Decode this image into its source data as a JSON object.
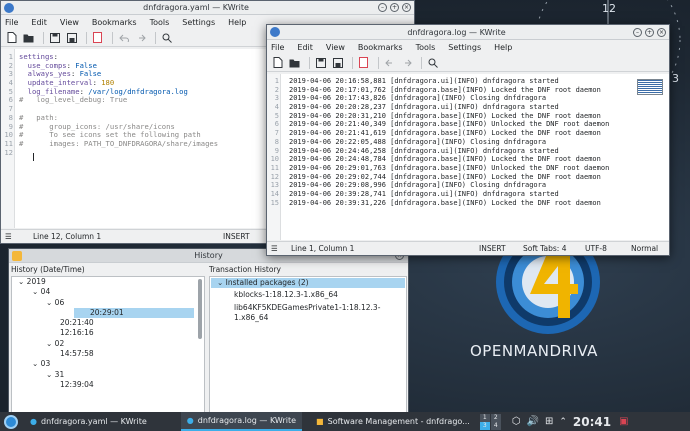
{
  "yaml_window": {
    "title": "dnfdragora.yaml — KWrite",
    "menu": [
      "File",
      "Edit",
      "View",
      "Bookmarks",
      "Tools",
      "Settings",
      "Help"
    ],
    "lines": [
      {
        "n": "1",
        "t": "settings:"
      },
      {
        "n": "2",
        "t": "  use_comps: False"
      },
      {
        "n": "3",
        "t": "  always_yes: False"
      },
      {
        "n": "4",
        "t": "  update_interval: 180"
      },
      {
        "n": "5",
        "t": "  log_filename: /var/log/dnfdragora.log"
      },
      {
        "n": "6",
        "t": "#   log_level_debug: True"
      },
      {
        "n": "7",
        "t": ""
      },
      {
        "n": "8",
        "t": "#   path:"
      },
      {
        "n": "9",
        "t": "#      group_icons: /usr/share/icons"
      },
      {
        "n": "10",
        "t": "#      To see icons set the following path"
      },
      {
        "n": "11",
        "t": "#      images: PATH_TO_DNFDRAGORA/share/images"
      },
      {
        "n": "12",
        "t": ""
      }
    ],
    "status_pos": "Line 12, Column 1",
    "status_mode": "INSERT"
  },
  "log_window": {
    "title": "dnfdragora.log — KWrite",
    "menu": [
      "File",
      "Edit",
      "View",
      "Bookmarks",
      "Tools",
      "Settings",
      "Help"
    ],
    "lines": [
      {
        "n": "1",
        "t": "2019-04-06 20:16:58,881 [dnfdragora.ui](INFO) dnfdragora started"
      },
      {
        "n": "2",
        "t": "2019-04-06 20:17:01,762 [dnfdragora.base](INFO) Locked the DNF root daemon"
      },
      {
        "n": "3",
        "t": "2019-04-06 20:17:43,826 [dnfdragora](INFO) Closing dnfdragora"
      },
      {
        "n": "4",
        "t": "2019-04-06 20:20:28,237 [dnfdragora.ui](INFO) dnfdragora started"
      },
      {
        "n": "5",
        "t": "2019-04-06 20:20:31,210 [dnfdragora.base](INFO) Locked the DNF root daemon"
      },
      {
        "n": "6",
        "t": "2019-04-06 20:21:40,349 [dnfdragora.base](INFO) Unlocked the DNF root daemon"
      },
      {
        "n": "7",
        "t": "2019-04-06 20:21:41,619 [dnfdragora.base](INFO) Locked the DNF root daemon"
      },
      {
        "n": "8",
        "t": "2019-04-06 20:22:05,488 [dnfdragora](INFO) Closing dnfdragora"
      },
      {
        "n": "9",
        "t": "2019-04-06 20:24:46,258 [dnfdragora.ui](INFO) dnfdragora started"
      },
      {
        "n": "10",
        "t": "2019-04-06 20:24:48,784 [dnfdragora.base](INFO) Locked the DNF root daemon"
      },
      {
        "n": "11",
        "t": "2019-04-06 20:29:01,763 [dnfdragora.base](INFO) Unlocked the DNF root daemon"
      },
      {
        "n": "12",
        "t": "2019-04-06 20:29:02,744 [dnfdragora.base](INFO) Locked the DNF root daemon"
      },
      {
        "n": "13",
        "t": "2019-04-06 20:29:08,996 [dnfdragora](INFO) Closing dnfdragora"
      },
      {
        "n": "14",
        "t": "2019-04-06 20:39:28,741 [dnfdragora.ui](INFO) dnfdragora started"
      },
      {
        "n": "15",
        "t": "2019-04-06 20:39:31,226 [dnfdragora.base](INFO) Locked the DNF root daemon"
      }
    ],
    "status_pos": "Line 1, Column 1",
    "status_mode": "INSERT",
    "status_tabs": "Soft Tabs: 4",
    "status_enc": "UTF-8",
    "status_mode2": "Normal"
  },
  "history_window": {
    "title": "History",
    "left_header": "History (Date/Time)",
    "right_header": "Transaction History",
    "tree": [
      {
        "label": "2019",
        "indent": 0,
        "exp": "⌄"
      },
      {
        "label": "04",
        "indent": 1,
        "exp": "⌄"
      },
      {
        "label": "06",
        "indent": 2,
        "exp": "⌄"
      },
      {
        "label": "20:29:01",
        "indent": 3,
        "exp": "",
        "sel": true
      },
      {
        "label": "20:21:40",
        "indent": 3,
        "exp": ""
      },
      {
        "label": "12:16:16",
        "indent": 3,
        "exp": ""
      },
      {
        "label": "02",
        "indent": 2,
        "exp": "⌄"
      },
      {
        "label": "14:57:58",
        "indent": 3,
        "exp": ""
      },
      {
        "label": "03",
        "indent": 1,
        "exp": "⌄"
      },
      {
        "label": "31",
        "indent": 2,
        "exp": "⌄"
      },
      {
        "label": "12:39:04",
        "indent": 3,
        "exp": ""
      }
    ],
    "installed_label": "Installed packages (2)",
    "packages": [
      "kblocks-1:18.12.3-1.x86_64",
      "lib64KF5KDEGamesPrivate1-1:18.12.3-1.x86_64"
    ]
  },
  "desktop": {
    "clock_12": "12",
    "clock_3": "3",
    "logo_text": "OPENMANDRIVA"
  },
  "taskbar": {
    "tasks": [
      "dnfdragora.yaml — KWrite",
      "dnfdragora.log — KWrite",
      "Software Management - dnfdrago..."
    ],
    "pager": [
      "1",
      "2",
      "3",
      "4"
    ],
    "time": "20:41"
  }
}
